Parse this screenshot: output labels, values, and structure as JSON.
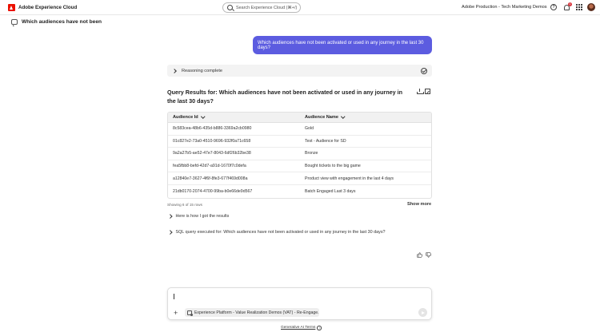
{
  "header": {
    "app_name": "Adobe Experience Cloud",
    "search_placeholder": "Search Experience Cloud (⌘+/)",
    "org_name": "Adobe Production - Tech Marketing Demos",
    "notifications_count": "1",
    "help_icon": "help-icon",
    "bell_icon": "bell-icon",
    "apps_icon": "apps-grid-icon"
  },
  "conversation": {
    "title": "Which audiences have not been",
    "user_message": "Which audiences have not been activated or used in any journey in the last 30 days?",
    "reasoning_label": "Reasoning complete"
  },
  "results": {
    "title": "Query Results for: Which audiences have not been activated or used in any journey in the last 30 days?",
    "columns": [
      "Audience Id",
      "Audience Name"
    ],
    "rows": [
      [
        "8c583cea-48b6-435d-b886-3369a2cb0980",
        "Gold"
      ],
      [
        "01c827e2-73a0-4510-9696-932f0a71c658",
        "Test - Audience for SD"
      ],
      [
        "9a2a27b5-ae52-47e7-8043-6df26b32be38",
        "Bronze"
      ],
      [
        "fea5fbb8-befd-42d7-a91d-1670f7c0defa",
        "Bought tickets to the big game"
      ],
      [
        "a12840e7-3627-4f6f-8fe3-677f469d008a",
        "Product view with engagement in the last 4 days"
      ],
      [
        "21db0170-2074-4700-99ba-b0e66de9d567",
        "Batch Engaged Last 3 days"
      ]
    ],
    "showing_text": "Showing 6 of 15 rows",
    "show_more": "Show more",
    "how_i_got": "Here is how I got the results",
    "sql_label": "SQL query executed for: Which audiences have not been activated or used in any journey in the last 30 days?"
  },
  "composer": {
    "context_chip": "Experience Platform - Value Realization Demos (VAT) - Re-Engage...",
    "terms": "Generative AI Terms"
  },
  "colors": {
    "accent": "#5c5ce0",
    "brand": "#eb1000"
  }
}
